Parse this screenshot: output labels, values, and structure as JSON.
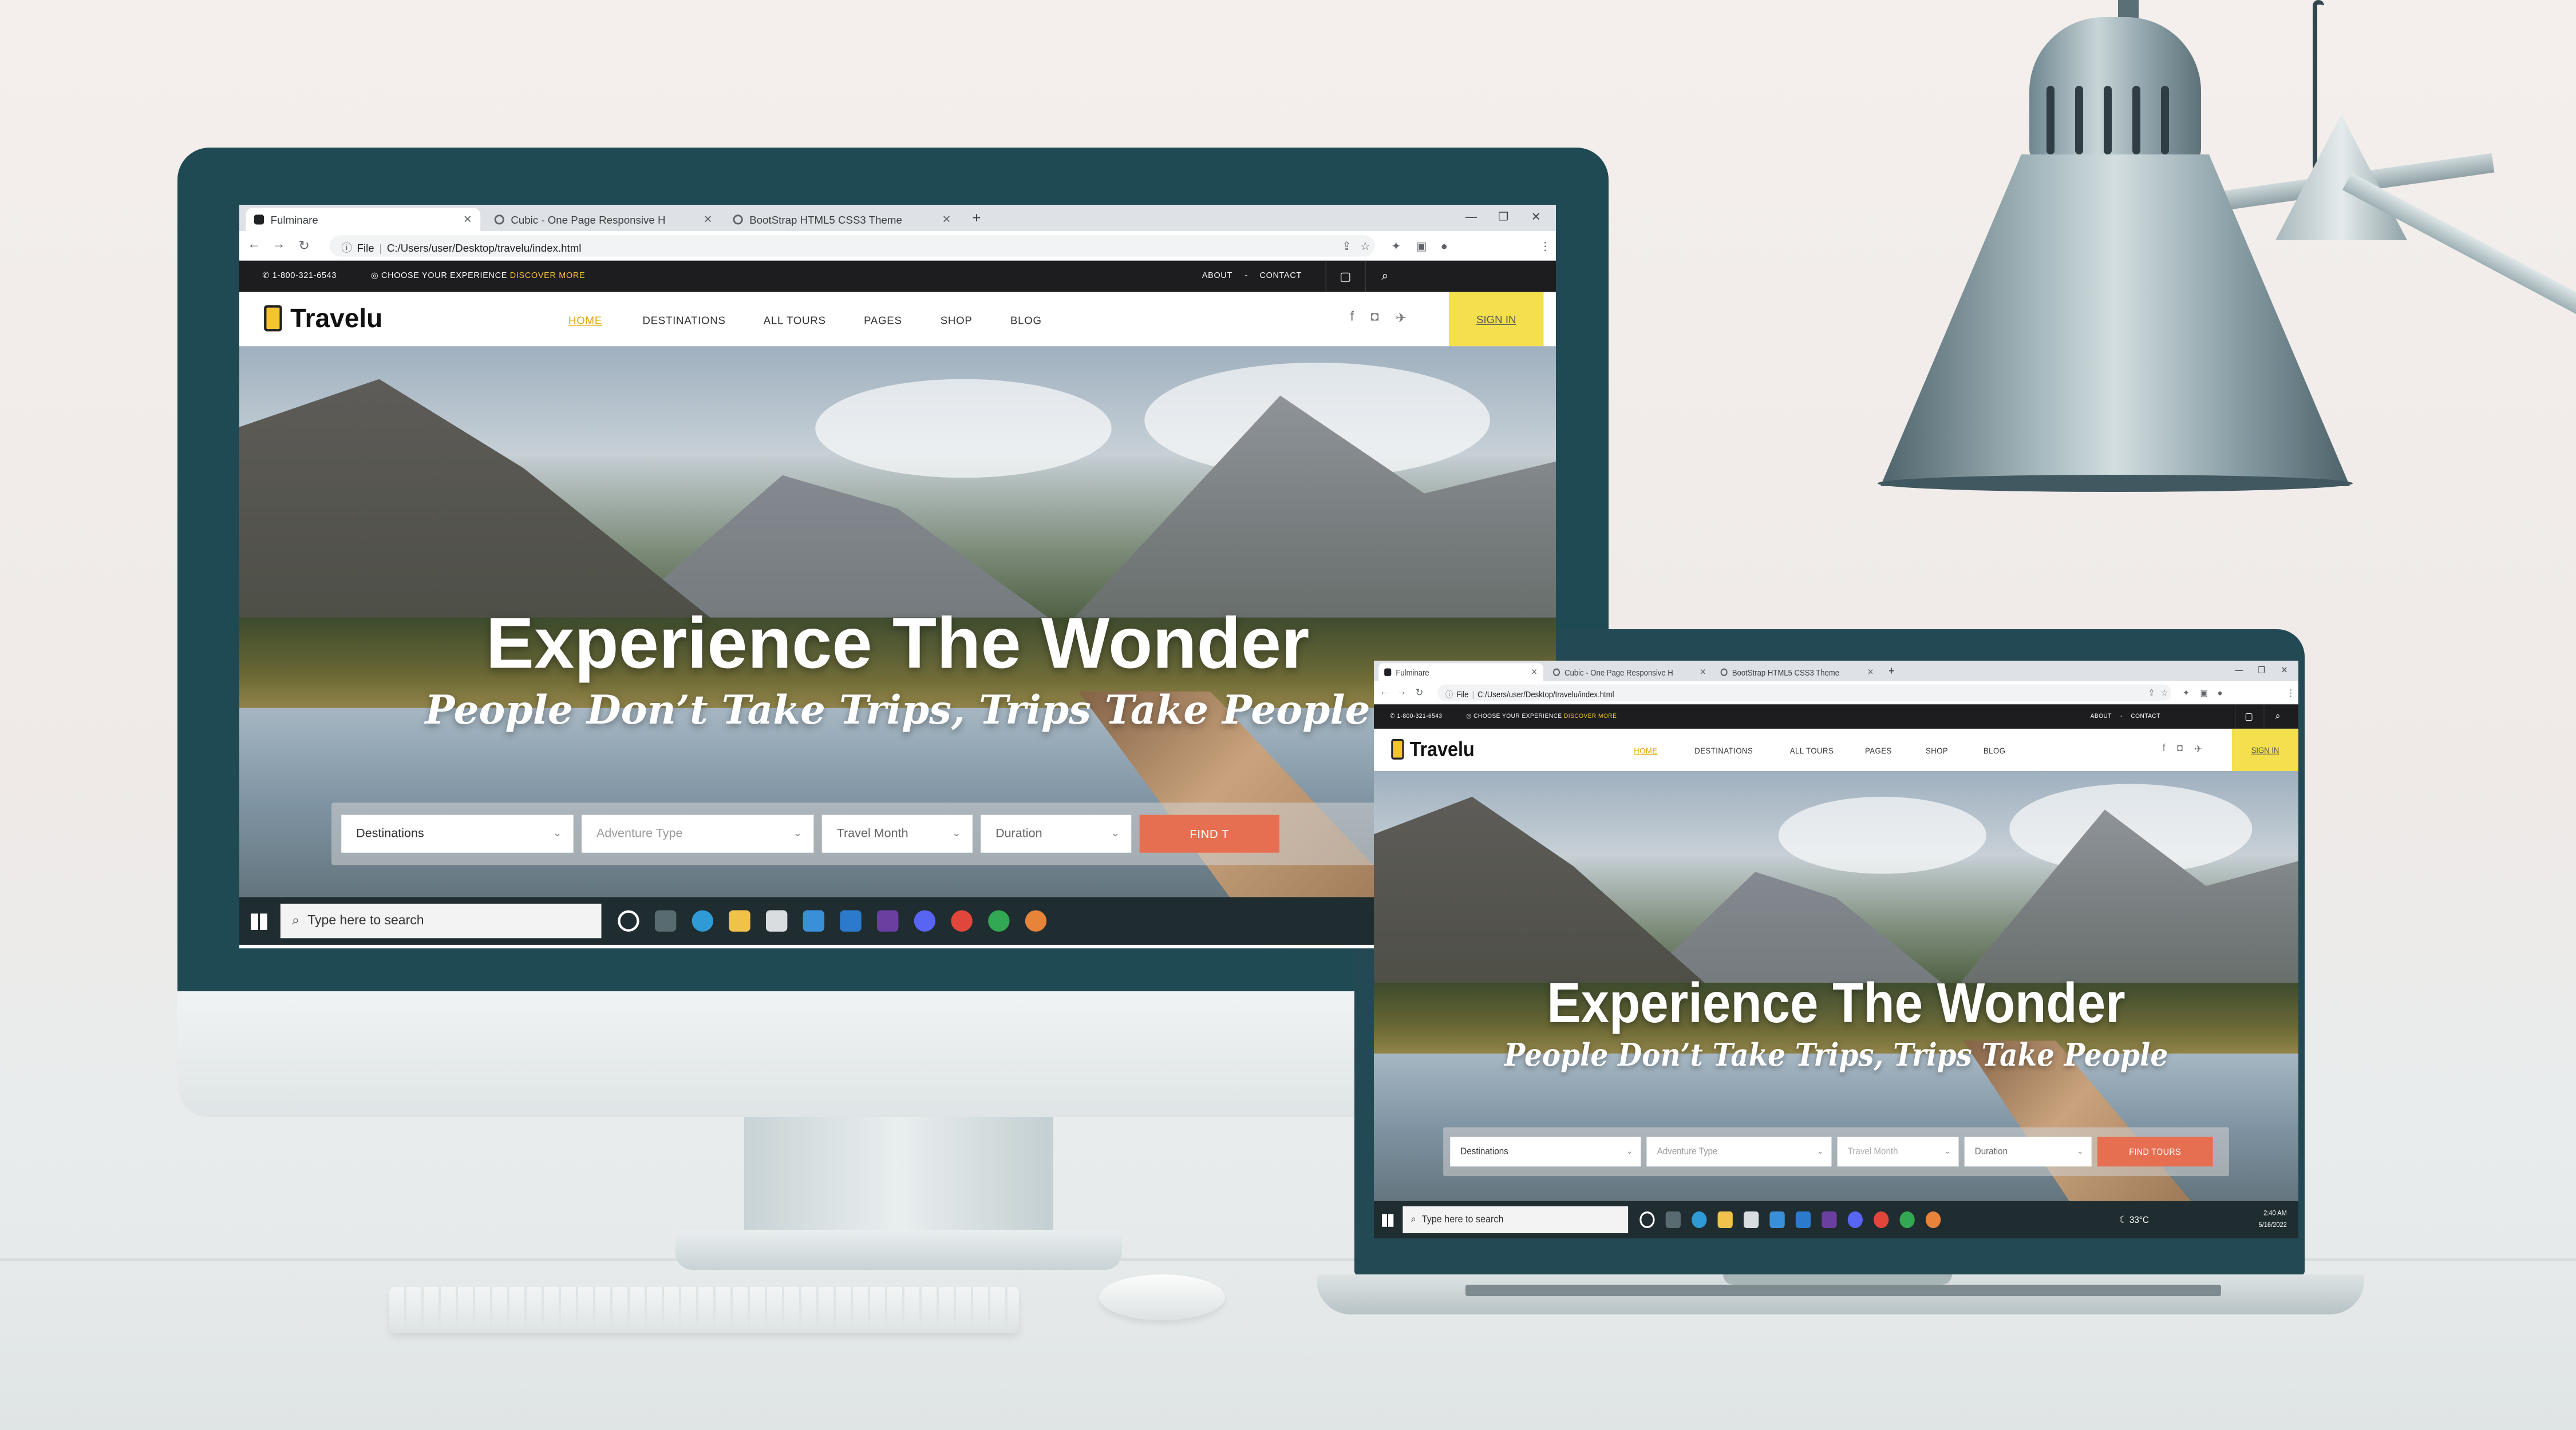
{
  "browser": {
    "tabs": [
      {
        "title": "Fulminare",
        "icon": "page-icon",
        "active": true
      },
      {
        "title": "Cubic - One Page Responsive H",
        "icon": "globe-icon",
        "active": false
      },
      {
        "title": "BootStrap HTML5 CSS3 Theme",
        "icon": "globe-icon",
        "active": false
      }
    ],
    "address": {
      "scheme": "File",
      "path": "C:/Users/user/Desktop/travelu/index.html"
    }
  },
  "site": {
    "topbar": {
      "phone": "1-800-321-6543",
      "choose": "CHOOSE YOUR EXPERIENCE",
      "discover": "DISCOVER MORE",
      "about": "ABOUT",
      "sep": "-",
      "contact": "CONTACT"
    },
    "logo": "Travelu",
    "nav": [
      "HOME",
      "DESTINATIONS",
      "ALL TOURS",
      "PAGES",
      "SHOP",
      "BLOG"
    ],
    "signin": "SIGN IN",
    "hero": {
      "title": "Experience The Wonder",
      "subtitle": "People Don’t Take Trips, Trips Take People"
    },
    "search": {
      "destinations": "Destinations",
      "adventure_type": "Adventure Type",
      "travel_month": "Travel Month",
      "duration": "Duration",
      "find_tours": "FIND TOURS",
      "find_tours_desktop": "FIND T"
    }
  },
  "taskbar": {
    "search_placeholder": "Type here to search",
    "temperature": "33°C",
    "time": "2:40 AM",
    "date": "5/16/2022"
  },
  "colors": {
    "accent_yellow": "#f4c430",
    "signin_bg": "#f4e04d",
    "find_button": "#e76f51",
    "topbar_bg": "#1d1d1f",
    "bezel": "#1f4a54"
  }
}
